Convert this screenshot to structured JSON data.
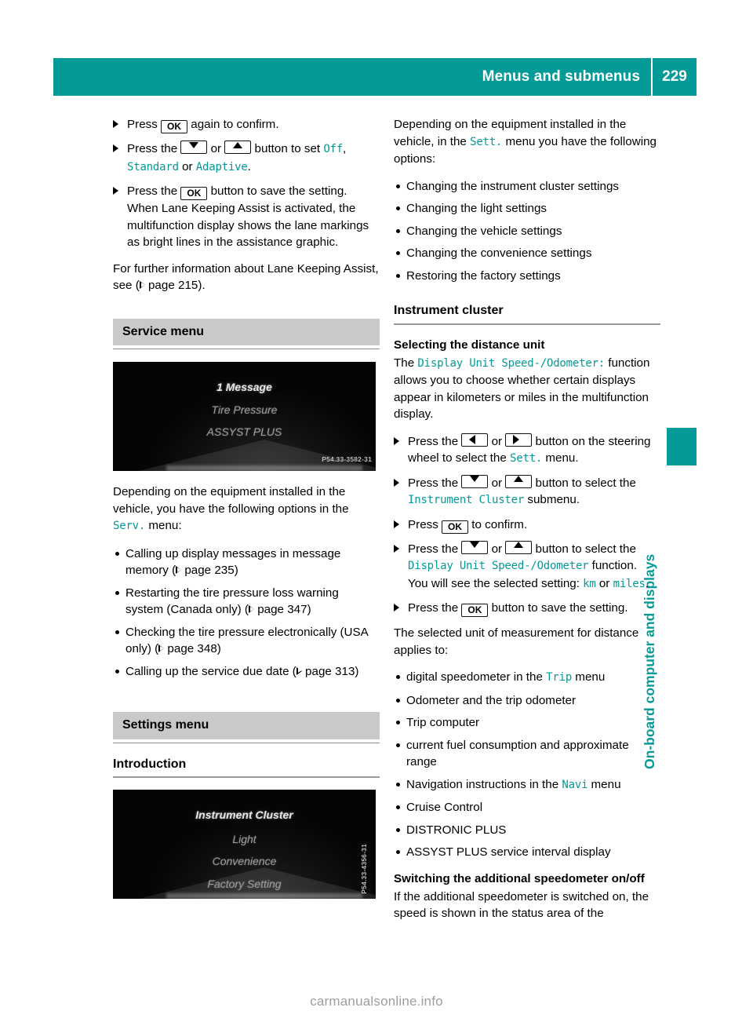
{
  "header": {
    "title": "Menus and submenus",
    "page_number": "229"
  },
  "side_tab": {
    "label": "On-board computer and displays",
    "accent_color": "#049a97"
  },
  "left_column": {
    "steps_top": [
      {
        "prefix": "Press ",
        "key": "OK",
        "suffix": " again to confirm."
      }
    ],
    "step_set_mode": {
      "t1": "Press the ",
      "t2": " or ",
      "t3": " button to set ",
      "v1": "Off",
      "t4": ", ",
      "v2": "Standard",
      "t5": " or ",
      "v3": "Adaptive",
      "t6": "."
    },
    "step_save": {
      "t1": "Press the ",
      "key": "OK",
      "t2": " button to save the setting. When Lane Keeping Assist is activated, the multifunction display shows the lane markings as bright lines in the assistance graphic."
    },
    "para_further": {
      "t1": "For further information about Lane Keeping Assist, see (",
      "t2": " page 215)."
    },
    "service_menu_heading": "Service menu",
    "figure_service": {
      "line1": "1 Message",
      "line2": "Tire Pressure",
      "line3": "ASSYST PLUS",
      "code": "P54.33-3582-31"
    },
    "para_options": {
      "t1": "Depending on the equipment installed in the vehicle, you have the following options in the ",
      "v1": "Serv.",
      "t2": " menu:"
    },
    "options": [
      {
        "t1": "Calling up display messages in message memory (",
        "t2": " page 235)"
      },
      {
        "t1": "Restarting the tire pressure loss warning system (Canada only) (",
        "t2": " page 347)"
      },
      {
        "t1": "Checking the tire pressure electronically (USA only) (",
        "t2": " page 348)"
      },
      {
        "t1": "Calling up the service due date (",
        "t2": " page 313)"
      }
    ],
    "settings_menu_heading": "Settings menu",
    "introduction_heading": "Introduction",
    "figure_settings": {
      "line1": "Instrument Cluster",
      "line2": "Light",
      "line3": "Convenience",
      "line4": "Factory Setting",
      "code": "P54.33-4356-31"
    }
  },
  "right_column": {
    "para_depending": {
      "t1": "Depending on the equipment installed in the vehicle, in the ",
      "v1": "Sett.",
      "t2": " menu you have the following options:"
    },
    "options": [
      "Changing the instrument cluster settings",
      "Changing the light settings",
      "Changing the vehicle settings",
      "Changing the convenience settings",
      "Restoring the factory settings"
    ],
    "instrument_cluster_heading": "Instrument cluster",
    "distance_unit_heading": "Selecting the distance unit",
    "para_display_unit": {
      "t1": "The ",
      "v1": "Display Unit Speed-/Odometer:",
      "t2": " function allows you to choose whether certain displays appear in kilometers or miles in the multifunction display."
    },
    "step_select_sett": {
      "t1": "Press the ",
      "t2": " or ",
      "t3": " button on the steering wheel to select the ",
      "v1": "Sett.",
      "t4": " menu."
    },
    "step_select_cluster": {
      "t1": "Press the ",
      "t2": " or ",
      "t3": " button to select the ",
      "v1": "Instrument Cluster",
      "t4": " submenu."
    },
    "step_confirm": {
      "t1": "Press ",
      "key": "OK",
      "t2": " to confirm."
    },
    "step_select_function": {
      "t1": "Press the ",
      "t2": " or ",
      "t3": " button to select the ",
      "v1": "Display Unit Speed-/Odometer",
      "t4": " function.",
      "t5": "You will see the selected setting: ",
      "v2": "km",
      "t6": " or ",
      "v3": "miles",
      "t7": "."
    },
    "step_save": {
      "t1": "Press the ",
      "key": "OK",
      "t2": " button to save the setting."
    },
    "para_applies": "The selected unit of measurement for distance applies to:",
    "applies_list": [
      {
        "t1": "digital speedometer in the ",
        "v1": "Trip",
        "t2": " menu"
      },
      {
        "t1": "Odometer and the trip odometer"
      },
      {
        "t1": "Trip computer"
      },
      {
        "t1": "current fuel consumption and approximate range"
      },
      {
        "t1": "Navigation instructions in the ",
        "v1": "Navi",
        "t2": " menu"
      },
      {
        "t1": "Cruise Control"
      },
      {
        "t1": "DISTRONIC PLUS"
      },
      {
        "t1": "ASSYST PLUS service interval display"
      }
    ],
    "speedometer_heading": "Switching the additional speedometer on/off",
    "para_speedometer": "If the additional speedometer is switched on, the speed is shown in the status area of the"
  },
  "footer": {
    "watermark": "carmanualsonline.info"
  }
}
